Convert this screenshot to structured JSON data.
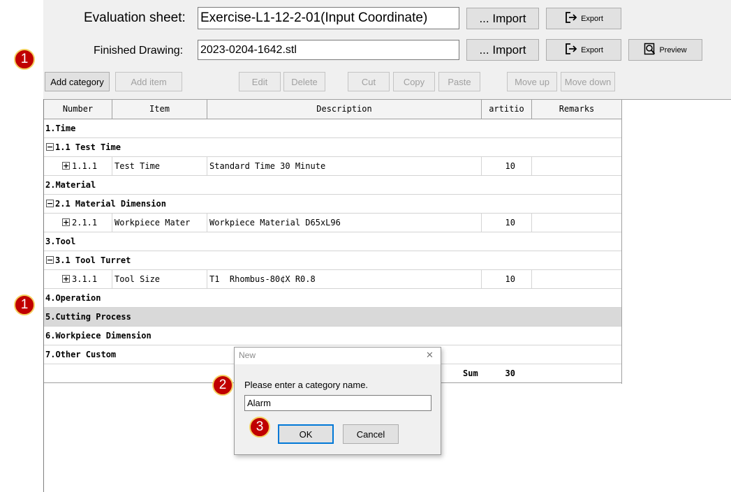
{
  "toolbar": {
    "eval_label": "Evaluation sheet:",
    "eval_value": "Exercise-L1-12-2-01(Input Coordinate)",
    "drawing_label": "Finished Drawing:",
    "drawing_value": "2023-0204-1642.stl",
    "import_label": "... Import",
    "export_label": "Export",
    "preview_label": "Preview"
  },
  "actions": {
    "add_category": "Add category",
    "add_item": "Add item",
    "edit": "Edit",
    "delete": "Delete",
    "cut": "Cut",
    "copy": "Copy",
    "paste": "Paste",
    "move_up": "Move up",
    "move_down": "Move down"
  },
  "table": {
    "columns": [
      "Number",
      "Item",
      "Description",
      "artitio",
      "Remarks"
    ],
    "rows": [
      {
        "number": "1.Time"
      },
      {
        "number": "1.1 Test Time"
      },
      {
        "number": "1.1.1",
        "item": "Test Time",
        "description": "Standard Time 30 Minute",
        "value": "10"
      },
      {
        "number": "2.Material"
      },
      {
        "number": "2.1 Material Dimension"
      },
      {
        "number": "2.1.1",
        "item": "Workpiece Mater",
        "description": "Workpiece Material D65xL96",
        "value": "10"
      },
      {
        "number": "3.Tool"
      },
      {
        "number": "3.1 Tool Turret"
      },
      {
        "number": "3.1.1",
        "item": "Tool Size",
        "description": "T1  Rhombus-80¢X R0.8",
        "value": "10"
      },
      {
        "number": "4.Operation"
      },
      {
        "number": "5.Cutting Process"
      },
      {
        "number": "6.Workpiece Dimension"
      },
      {
        "number": "7.Other Custom"
      }
    ],
    "sum_label": "Sum",
    "sum_value": "30"
  },
  "dialog": {
    "title": "New",
    "close": "✕",
    "prompt": "Please enter a category name.",
    "input_value": "Alarm",
    "ok": "OK",
    "cancel": "Cancel"
  },
  "badges": {
    "b1": "1",
    "b2": "1",
    "b3": "2",
    "b4": "3"
  },
  "colors": {
    "badge": "#c00000",
    "badge_border": "#f4d060",
    "selected_row": "#d9d9d9"
  }
}
